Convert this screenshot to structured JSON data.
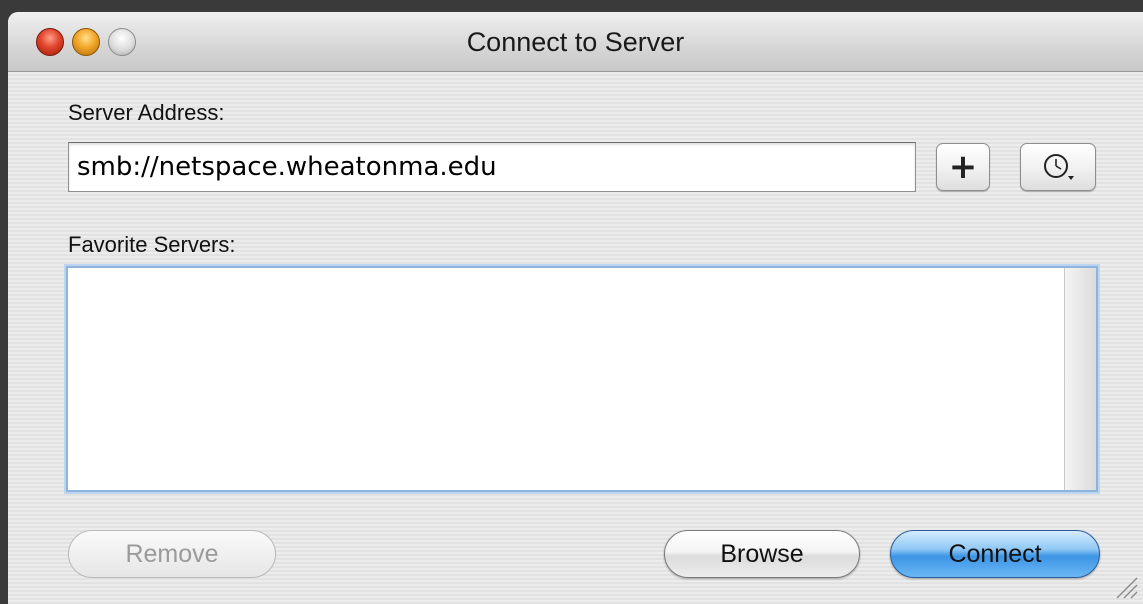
{
  "window": {
    "title": "Connect to Server"
  },
  "server_address": {
    "label": "Server Address:",
    "value": "smb://netspace.wheatonma.edu"
  },
  "add_button": {
    "label": "+",
    "icon": "plus-icon"
  },
  "recent_button": {
    "icon": "clock-icon"
  },
  "favorites": {
    "label": "Favorite Servers:",
    "items": []
  },
  "buttons": {
    "remove": "Remove",
    "browse": "Browse",
    "connect": "Connect"
  },
  "colors": {
    "focus_ring": "#8fb4dc",
    "default_button": "#3d95e6"
  }
}
